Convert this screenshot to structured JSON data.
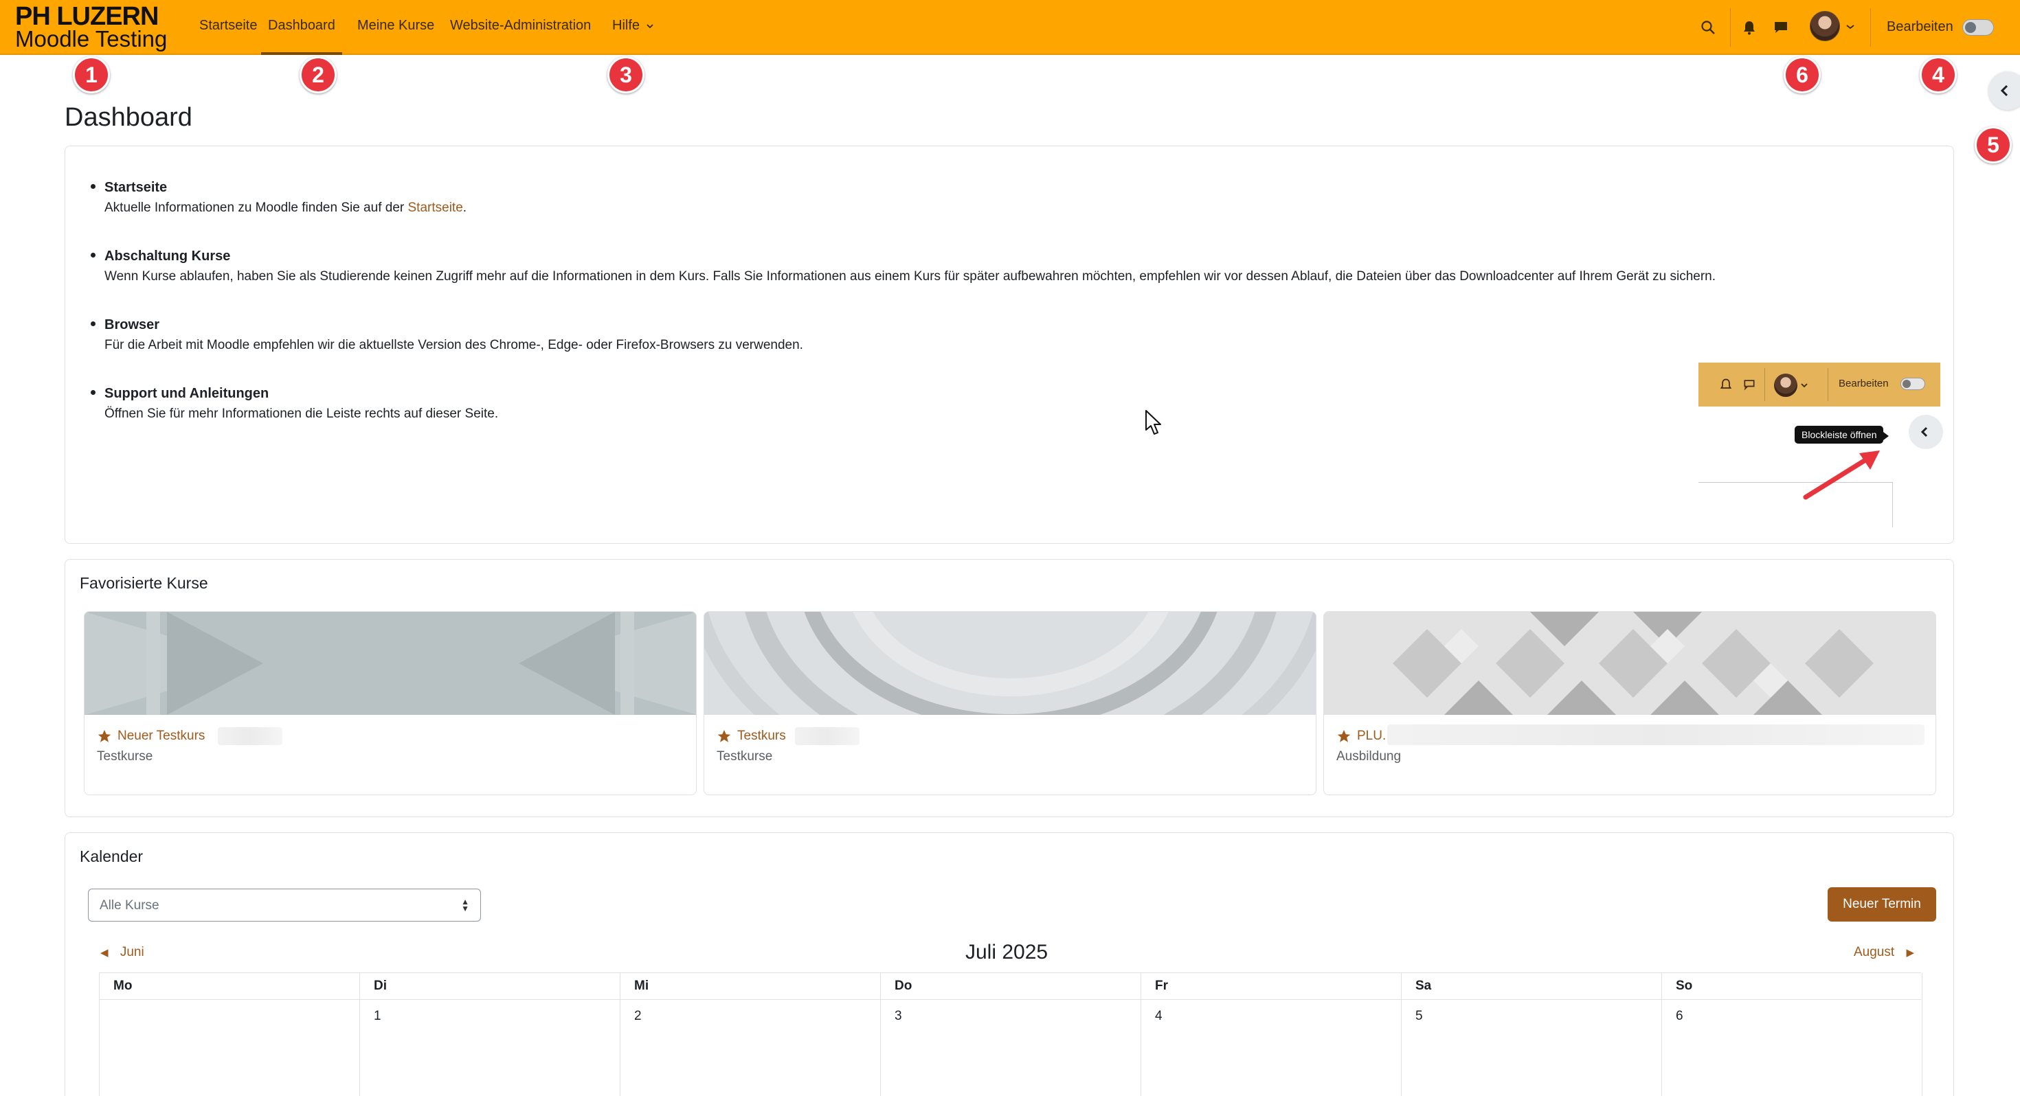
{
  "brand": {
    "line1": "PH LUZERN",
    "line2": "Moodle Testing"
  },
  "nav": {
    "items": [
      {
        "label": "Startseite"
      },
      {
        "label": "Dashboard",
        "active": true
      },
      {
        "label": "Meine Kurse"
      },
      {
        "label": "Website-Administration"
      },
      {
        "label": "Hilfe"
      }
    ],
    "right": {
      "edit_label": "Bearbeiten"
    }
  },
  "badges": [
    "1",
    "2",
    "3",
    "4",
    "5",
    "6"
  ],
  "page": {
    "title": "Dashboard"
  },
  "info": {
    "items": [
      {
        "title": "Startseite",
        "text_before": "Aktuelle Informationen zu Moodle finden Sie auf der ",
        "link": "Startseite",
        "text_after": "."
      },
      {
        "title": "Abschaltung Kurse",
        "text": "Wenn Kurse ablaufen, haben Sie als Studierende keinen Zugriff mehr auf die Informationen in dem Kurs. Falls Sie Informationen aus einem Kurs für später aufbewahren möchten, empfehlen wir vor dessen Ablauf, die Dateien über das Downloadcenter auf Ihrem Gerät zu sichern."
      },
      {
        "title": "Browser",
        "text": "Für die Arbeit mit Moodle empfehlen wir die aktuellste Version des Chrome-, Edge- oder Firefox-Browsers zu verwenden."
      },
      {
        "title": "Support und Anleitungen",
        "text": "Öffnen Sie für mehr Informationen die Leiste rechts auf dieser Seite."
      }
    ],
    "hint_image": {
      "edit_label": "Bearbeiten",
      "tooltip": "Blockleiste öffnen"
    }
  },
  "favorites": {
    "title": "Favorisierte Kurse",
    "courses": [
      {
        "name": "Neuer Testkurs",
        "category": "Testkurse"
      },
      {
        "name": "Testkurs",
        "category": "Testkurse"
      },
      {
        "name": "PLU.",
        "category": "Ausbildung"
      }
    ]
  },
  "calendar": {
    "title": "Kalender",
    "filter_value": "Alle Kurse",
    "new_event_label": "Neuer Termin",
    "prev_month": "Juni",
    "next_month": "August",
    "month_title": "Juli 2025",
    "weekdays": [
      "Mo",
      "Di",
      "Mi",
      "Do",
      "Fr",
      "Sa",
      "So"
    ],
    "first_week": [
      "",
      "1",
      "2",
      "3",
      "4",
      "5",
      "6"
    ]
  },
  "colors": {
    "navbar": "#ffa500",
    "accent": "#a05a1c",
    "badge": "#e8343c"
  }
}
